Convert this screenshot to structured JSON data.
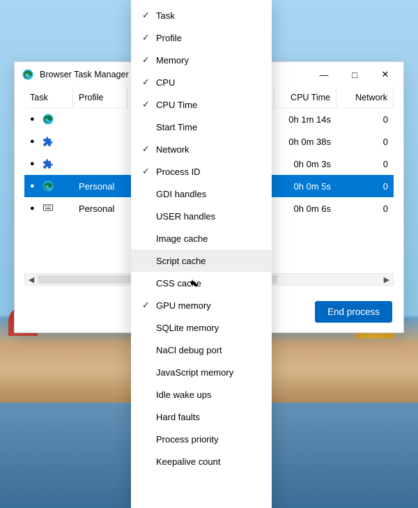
{
  "window": {
    "title": "Browser Task Manager",
    "end_process_label": "End process"
  },
  "columns": {
    "task": "Task",
    "profile": "Profile",
    "cpu_time": "CPU Time",
    "network": "Network"
  },
  "rows": [
    {
      "icon": "edge",
      "profile": "",
      "cpu_time": "0h 1m 14s",
      "network": "0",
      "selected": false
    },
    {
      "icon": "extension",
      "profile": "",
      "cpu_time": "0h 0m 38s",
      "network": "0",
      "selected": false
    },
    {
      "icon": "extension",
      "profile": "",
      "cpu_time": "0h 0m 3s",
      "network": "0",
      "selected": false
    },
    {
      "icon": "edge",
      "profile": "Personal",
      "cpu_time": "0h 0m 5s",
      "network": "0",
      "selected": true
    },
    {
      "icon": "keyboard",
      "profile": "Personal",
      "cpu_time": "0h 0m 6s",
      "network": "0",
      "selected": false
    }
  ],
  "context_menu": {
    "hovered_index": 11,
    "items": [
      {
        "label": "Task",
        "checked": true
      },
      {
        "label": "Profile",
        "checked": true
      },
      {
        "label": "Memory",
        "checked": true
      },
      {
        "label": "CPU",
        "checked": true
      },
      {
        "label": "CPU Time",
        "checked": true
      },
      {
        "label": "Start Time",
        "checked": false
      },
      {
        "label": "Network",
        "checked": true
      },
      {
        "label": "Process ID",
        "checked": true
      },
      {
        "label": "GDI handles",
        "checked": false
      },
      {
        "label": "USER handles",
        "checked": false
      },
      {
        "label": "Image cache",
        "checked": false
      },
      {
        "label": "Script cache",
        "checked": false
      },
      {
        "label": "CSS cache",
        "checked": false
      },
      {
        "label": "GPU memory",
        "checked": true
      },
      {
        "label": "SQLite memory",
        "checked": false
      },
      {
        "label": "NaCl debug port",
        "checked": false
      },
      {
        "label": "JavaScript memory",
        "checked": false
      },
      {
        "label": "Idle wake ups",
        "checked": false
      },
      {
        "label": "Hard faults",
        "checked": false
      },
      {
        "label": "Process priority",
        "checked": false
      },
      {
        "label": "Keepalive count",
        "checked": false
      }
    ]
  },
  "icons": {
    "edge": "edge-icon",
    "extension": "extension-icon",
    "keyboard": "keyboard-icon"
  }
}
